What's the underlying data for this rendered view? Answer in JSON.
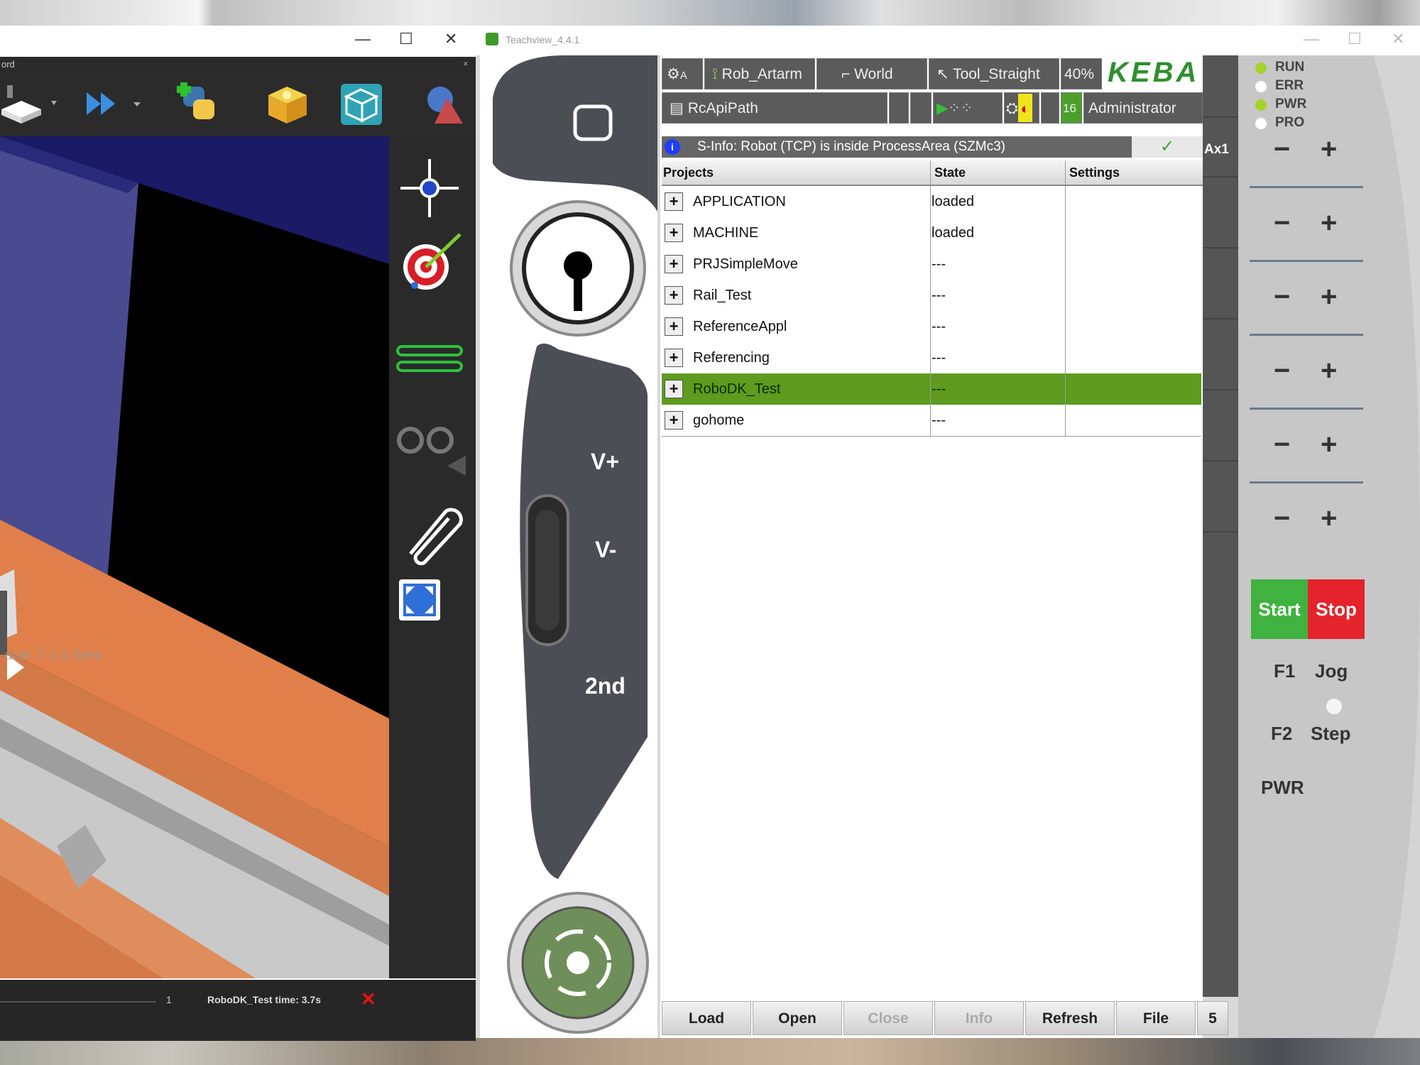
{
  "robodk": {
    "menu_fragment": "ord",
    "viewport_label": "acer 7-1.4 Sere",
    "status": {
      "counter": "1",
      "program_text": "RoboDK_Test time: 3.7s"
    },
    "icons": [
      "box-icon",
      "fast-forward-icon",
      "python-icon",
      "gift-icon",
      "wireframe-cube-icon",
      "shapes-icon",
      "move-target-icon",
      "target-icon",
      "lines-icon",
      "run-icon",
      "paperclip-icon",
      "fit-icon"
    ]
  },
  "teachview": {
    "title": "Teachview_4.4.1",
    "header1": {
      "coord": "A",
      "robot": "Rob_Artarm",
      "frame": "World",
      "tool": "Tool_Straight",
      "override": "40%",
      "logo": "KEBA"
    },
    "header2": {
      "program": "RcApiPath",
      "user_level": "16",
      "user": "Administrator"
    },
    "info_bar": {
      "icon": "i",
      "text": "S-Info: Robot (TCP) is inside ProcessArea (SZMc3)"
    },
    "table": {
      "columns": [
        "Projects",
        "State",
        "Settings"
      ],
      "rows": [
        {
          "project": "APPLICATION",
          "state": "loaded",
          "settings": ""
        },
        {
          "project": "MACHINE",
          "state": "loaded",
          "settings": ""
        },
        {
          "project": "PRJSimpleMove",
          "state": "---",
          "settings": ""
        },
        {
          "project": "Rail_Test",
          "state": "---",
          "settings": ""
        },
        {
          "project": "ReferenceAppl",
          "state": "---",
          "settings": ""
        },
        {
          "project": "Referencing",
          "state": "---",
          "settings": ""
        },
        {
          "project": "RoboDK_Test",
          "state": "---",
          "settings": "",
          "selected": true
        },
        {
          "project": "gohome",
          "state": "---",
          "settings": ""
        }
      ]
    },
    "buttons": [
      "Load",
      "Open",
      "Close",
      "Info",
      "Refresh",
      "File",
      "5"
    ],
    "axis_label": "Ax1",
    "pendant_keys": {
      "v_plus": "V+",
      "v_minus": "V-",
      "second": "2nd"
    },
    "leds": [
      {
        "label": "RUN",
        "color": "#a6d32a"
      },
      {
        "label": "ERR",
        "color": "#ffffff"
      },
      {
        "label": "PWR",
        "color": "#a6d32a"
      },
      {
        "label": "PRO",
        "color": "#ffffff"
      }
    ],
    "minus": "−",
    "plus": "+",
    "start": "Start",
    "stop": "Stop",
    "f1": "F1",
    "jog": "Jog",
    "f2": "F2",
    "step": "Step",
    "pwr": "PWR"
  }
}
